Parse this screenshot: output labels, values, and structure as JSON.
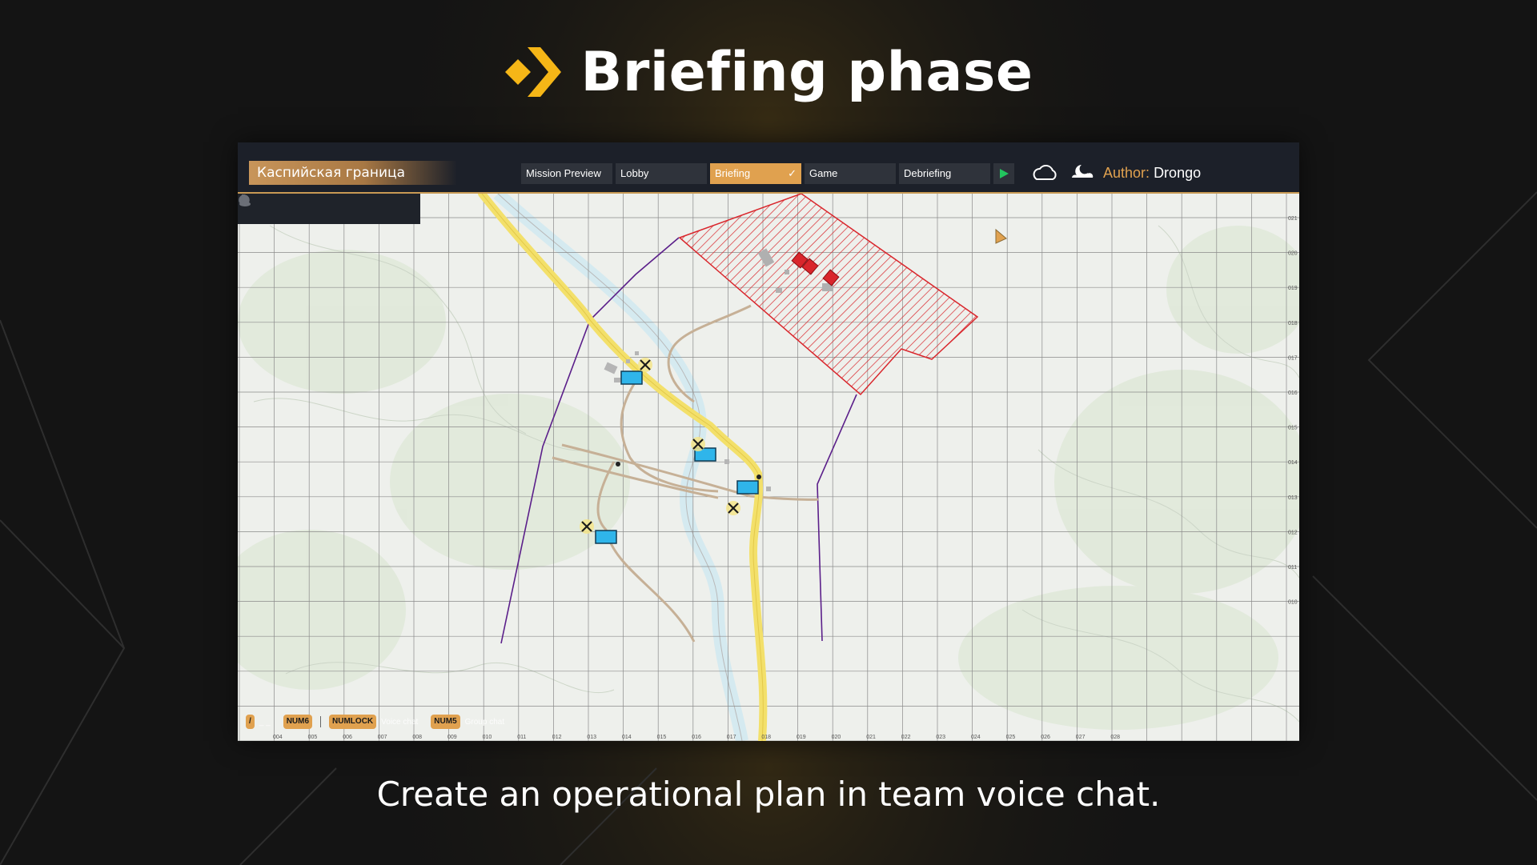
{
  "promo": {
    "headline": "Briefing phase",
    "caption": "Create an operational plan in team voice chat.",
    "accent_color": "#f5b617"
  },
  "window": {
    "mission_title": "Каспийская граница",
    "tabs": [
      {
        "label": "Mission Preview",
        "active": false
      },
      {
        "label": "Lobby",
        "active": false
      },
      {
        "label": "Briefing",
        "active": true,
        "check": "✓"
      },
      {
        "label": "Game",
        "active": false
      },
      {
        "label": "Debriefing",
        "active": false
      }
    ],
    "play_icon": "play-icon",
    "weather_icon": "cloud-icon",
    "time_icon": "night-moon-icon",
    "author_label": "Author:",
    "author_name": "Drongo",
    "accent_color": "#e0a14f"
  },
  "map": {
    "toolbox_icons": [
      "slider-icon",
      "compass-icon",
      "globe-icon",
      "pin-icon",
      "pencil-icon",
      "group-icon"
    ],
    "hints": {
      "slash_key": "/",
      "num6_key": "NUM6",
      "numlock_key": "NUMLOCK",
      "voice_chat": "Voice chat",
      "num5_key": "NUM5",
      "group_chat": "Group chat"
    },
    "bottom_grid_labels": [
      "004",
      "005",
      "006",
      "007",
      "008",
      "009",
      "010",
      "011",
      "012",
      "013",
      "014",
      "015",
      "016",
      "017",
      "018",
      "019",
      "020",
      "021",
      "022",
      "023",
      "024",
      "025",
      "026",
      "027",
      "028"
    ],
    "right_grid_labels": [
      "021",
      "020",
      "019",
      "018",
      "017",
      "016",
      "015",
      "014",
      "013",
      "012",
      "011",
      "010"
    ],
    "enemy_zone_color": "#d9262c",
    "friendly_unit_color": "#2fb5ea",
    "road_color": "#f3e06a",
    "boundary_color": "#5b1f8a"
  }
}
